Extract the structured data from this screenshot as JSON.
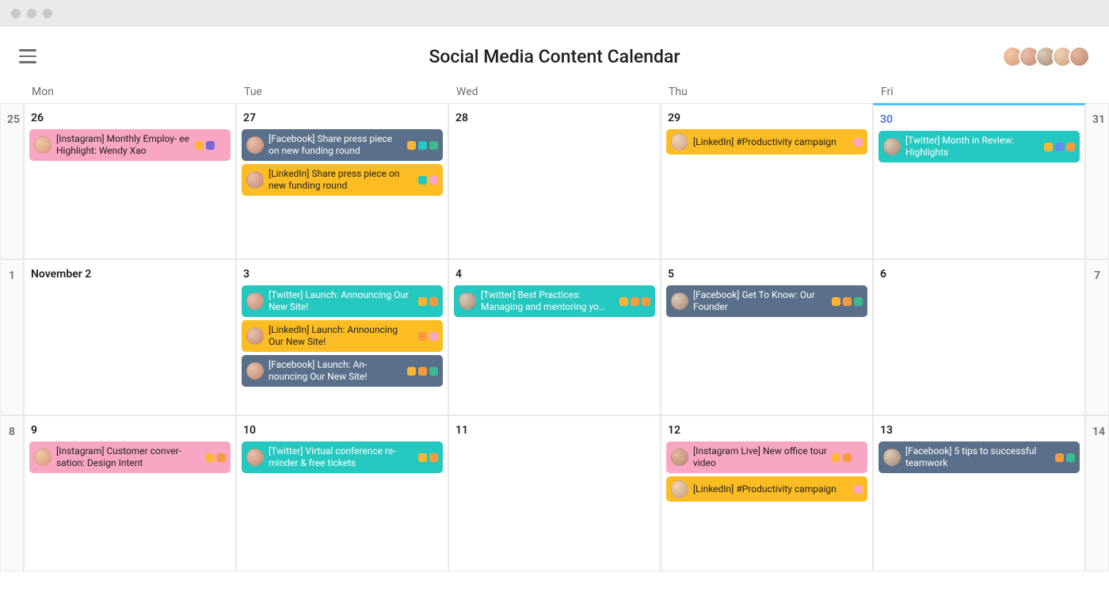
{
  "header": {
    "title": "Social Media Content Calendar"
  },
  "dayHeaders": [
    "Mon",
    "Tue",
    "Wed",
    "Thu",
    "Fri"
  ],
  "weeks": [
    {
      "leftEdge": "25",
      "rightEdge": "31",
      "days": [
        {
          "label": "26",
          "highlight": false,
          "cards": [
            {
              "color": "c-pink",
              "avatar": "av1",
              "title": "[Instagram] Monthly Employ-\nee Highlight: Wendy Xao",
              "tags": [
                "t-amber",
                "t-purple",
                "t-pink"
              ]
            }
          ]
        },
        {
          "label": "27",
          "highlight": false,
          "cards": [
            {
              "color": "c-slate",
              "avatar": "av2",
              "title": "[Facebook] Share press piece on new funding round",
              "tags": [
                "t-amber",
                "t-teal",
                "t-green"
              ]
            },
            {
              "color": "c-amber",
              "avatar": "av2",
              "title": "[LinkedIn] Share press piece on new funding round",
              "tags": [
                "t-teal",
                "t-pink"
              ]
            }
          ]
        },
        {
          "label": "28",
          "highlight": false,
          "cards": []
        },
        {
          "label": "29",
          "highlight": false,
          "cards": [
            {
              "color": "c-amber",
              "avatar": "av4",
              "title": "[LinkedIn] #Productivity campaign",
              "tags": [
                "t-pink"
              ]
            }
          ]
        },
        {
          "label": "30",
          "highlight": true,
          "cards": [
            {
              "color": "c-teal",
              "avatar": "av3",
              "title": "[Twitter] Month in Review: Highlights",
              "tags": [
                "t-amber",
                "t-blue",
                "t-orange"
              ]
            }
          ]
        }
      ]
    },
    {
      "leftEdge": "1",
      "rightEdge": "7",
      "days": [
        {
          "label": "November 2",
          "highlight": false,
          "cards": []
        },
        {
          "label": "3",
          "highlight": false,
          "cards": [
            {
              "color": "c-teal",
              "avatar": "av2",
              "title": "[Twitter] Launch: Announcing Our New Site!",
              "tags": [
                "t-amber",
                "t-orange"
              ]
            },
            {
              "color": "c-amber",
              "avatar": "av2",
              "title": "[LinkedIn] Launch: Announcing Our New Site!",
              "tags": [
                "t-orange",
                "t-pink"
              ]
            },
            {
              "color": "c-slate",
              "avatar": "av2",
              "title": "[Facebook] Launch: An-\nnouncing Our New Site!",
              "tags": [
                "t-amber",
                "t-orange",
                "t-green"
              ]
            }
          ]
        },
        {
          "label": "4",
          "highlight": false,
          "cards": [
            {
              "color": "c-teal",
              "avatar": "av3",
              "title": "[Twitter] Best Practices: Managing and mentoring yo…",
              "tags": [
                "t-amber",
                "t-orange",
                "t-orange"
              ]
            }
          ]
        },
        {
          "label": "5",
          "highlight": false,
          "cards": [
            {
              "color": "c-slate",
              "avatar": "av3",
              "title": "[Facebook] Get To Know: Our Founder",
              "tags": [
                "t-amber",
                "t-orange",
                "t-green"
              ]
            }
          ]
        },
        {
          "label": "6",
          "highlight": false,
          "cards": []
        }
      ]
    },
    {
      "leftEdge": "8",
      "rightEdge": "14",
      "days": [
        {
          "label": "9",
          "highlight": false,
          "cards": [
            {
              "color": "c-pink",
              "avatar": "av1",
              "title": "[Instagram] Customer conver-\nsation: Design Intent",
              "tags": [
                "t-amber",
                "t-orange"
              ]
            }
          ]
        },
        {
          "label": "10",
          "highlight": false,
          "cards": [
            {
              "color": "c-teal",
              "avatar": "av2",
              "title": "[Twitter] Virtual conference re-\nminder & free tickets",
              "tags": [
                "t-amber",
                "t-orange"
              ]
            }
          ]
        },
        {
          "label": "11",
          "highlight": false,
          "cards": []
        },
        {
          "label": "12",
          "highlight": false,
          "cards": [
            {
              "color": "c-pink",
              "avatar": "av5",
              "title": "[Instagram Live] New office tour video",
              "tags": [
                "t-amber",
                "t-orange",
                "t-pink"
              ]
            },
            {
              "color": "c-amber",
              "avatar": "av4",
              "title": "[LinkedIn] #Productivity campaign",
              "tags": [
                "t-pink"
              ]
            }
          ]
        },
        {
          "label": "13",
          "highlight": false,
          "cards": [
            {
              "color": "c-slate",
              "avatar": "av3",
              "title": "[Facebook] 5 tips to successful teamwork",
              "tags": [
                "t-orange",
                "t-green"
              ]
            }
          ]
        }
      ]
    }
  ]
}
